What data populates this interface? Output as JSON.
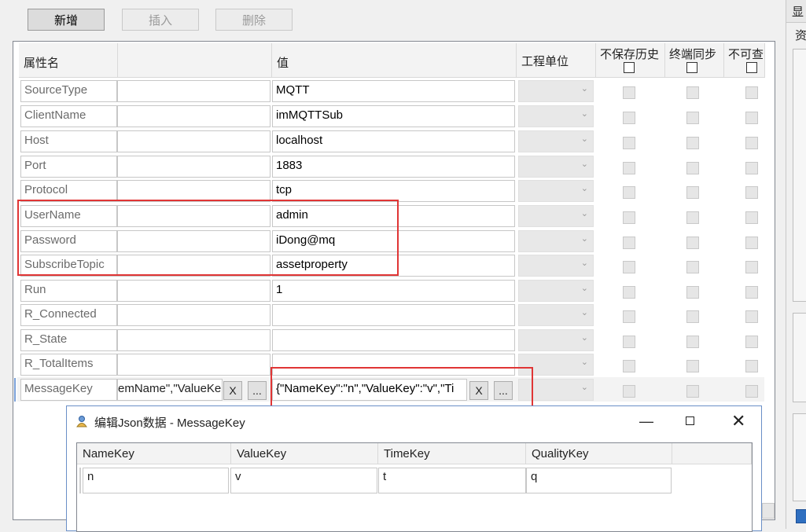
{
  "toolbar": {
    "add": "新增",
    "insert": "插入",
    "delete": "删除"
  },
  "columns": {
    "name": "属性名",
    "value": "值",
    "unit": "工程单位",
    "no_history": "不保存历史",
    "terminal_sync": "终端同步",
    "not_queryable": "不可查"
  },
  "rows": [
    {
      "name": "SourceType",
      "value": "MQTT"
    },
    {
      "name": "ClientName",
      "value": "imMQTTSub"
    },
    {
      "name": "Host",
      "value": "localhost"
    },
    {
      "name": "Port",
      "value": "1883"
    },
    {
      "name": "Protocol",
      "value": "tcp"
    },
    {
      "name": "UserName",
      "value": "admin"
    },
    {
      "name": "Password",
      "value": "iDong@mq"
    },
    {
      "name": "SubscribeTopic",
      "value": "assetproperty"
    },
    {
      "name": "Run",
      "value": "1"
    },
    {
      "name": "R_Connected",
      "value": ""
    },
    {
      "name": "R_State",
      "value": ""
    },
    {
      "name": "R_TotalItems",
      "value": ""
    },
    {
      "name": "MessageKey",
      "left": "emName\",\"ValueKe",
      "value": "{\"NameKey\":\"n\",\"ValueKey\":\"v\",\"Ti",
      "clear": "X",
      "more": "..."
    }
  ],
  "dialog": {
    "title": "编辑Json数据 - MessageKey",
    "headers": [
      "NameKey",
      "ValueKey",
      "TimeKey",
      "QualityKey"
    ],
    "values": [
      "n",
      "v",
      "t",
      "q"
    ]
  },
  "right_panel": {
    "labels": [
      "显",
      "资"
    ]
  },
  "colors": {
    "highlight": "#e03535",
    "accent": "#6a8fc7"
  }
}
